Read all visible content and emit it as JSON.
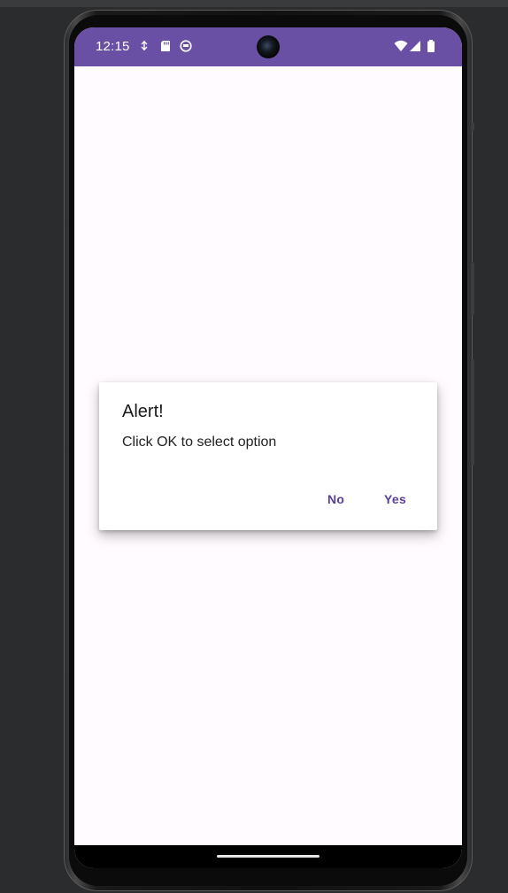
{
  "status_bar": {
    "time": "12:15",
    "left_icons": [
      "usb-debug-icon",
      "sd-card-icon",
      "app-notification-icon"
    ],
    "right_icons": [
      "wifi-icon",
      "cell-signal-icon",
      "battery-icon"
    ],
    "color": "#6a50a4"
  },
  "dialog": {
    "title": "Alert!",
    "message": "Click OK to select option",
    "negative_button": "No",
    "positive_button": "Yes",
    "button_color": "#5b3f98"
  },
  "colors": {
    "screen_background": "#fffbfe",
    "emulator_background": "#2b2c2e"
  }
}
